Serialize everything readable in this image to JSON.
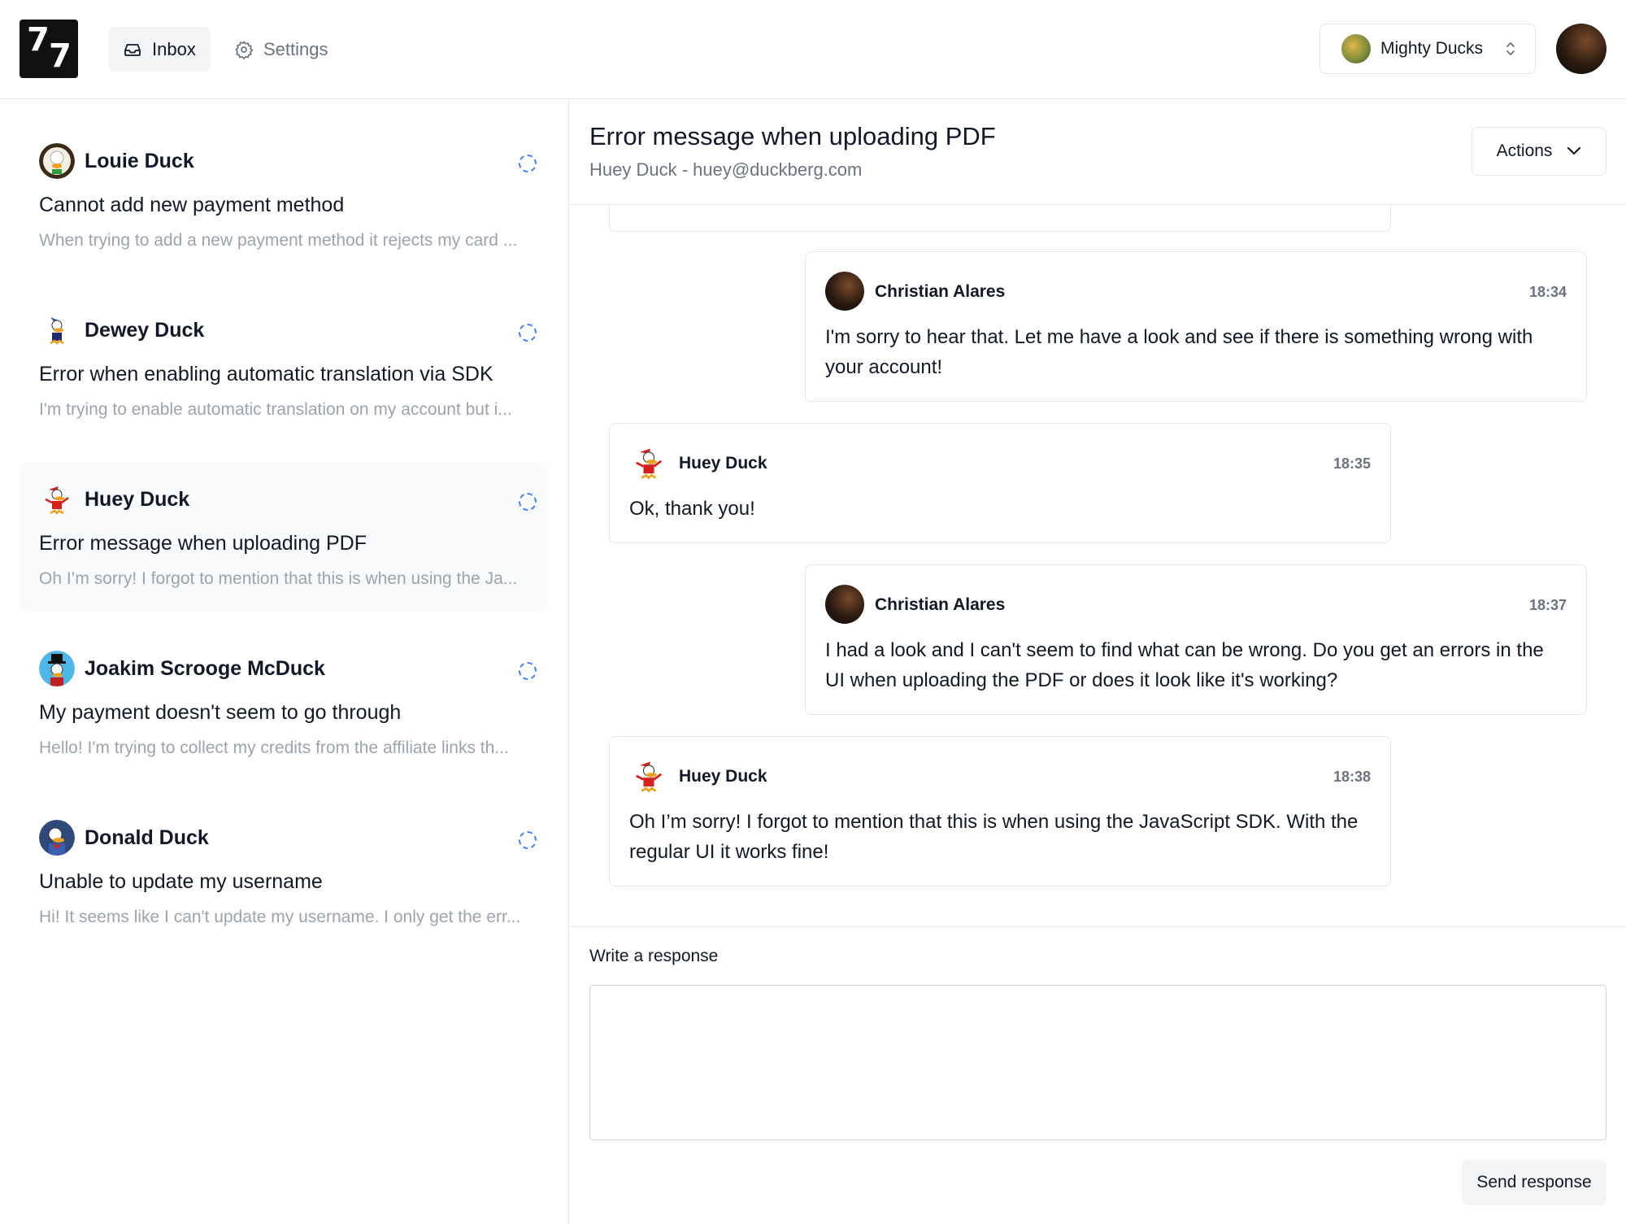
{
  "header": {
    "logo": {
      "d1": "7",
      "d2": "7"
    },
    "nav": {
      "inbox": "Inbox",
      "settings": "Settings"
    },
    "org": {
      "name": "Mighty Ducks"
    }
  },
  "sidebar": {
    "tickets": [
      {
        "name": "Louie Duck",
        "subject": "Cannot add new payment method",
        "preview": "When trying to add a new payment method it rejects my card ...",
        "avatar_color": "#f3efe2"
      },
      {
        "name": "Dewey Duck",
        "subject": "Error when enabling automatic translation via SDK",
        "preview": "I'm trying to enable automatic translation on my account but i...",
        "avatar_color": "#ffffff"
      },
      {
        "name": "Huey Duck",
        "subject": "Error message when uploading PDF",
        "preview": "Oh I’m sorry! I forgot to mention that this is when using the Ja...",
        "avatar_color": "#ffffff"
      },
      {
        "name": "Joakim Scrooge McDuck",
        "subject": "My payment doesn't seem to go through",
        "preview": "Hello! I'm trying to collect my credits from the affiliate links th...",
        "avatar_color": "#4db8e8"
      },
      {
        "name": "Donald Duck",
        "subject": "Unable to update my username",
        "preview": "Hi! It seems like I can't update my username. I only get the err...",
        "avatar_color": "#2f4a7a"
      }
    ]
  },
  "main": {
    "title": "Error message when uploading PDF",
    "subtitle": "Huey Duck - huey@duckberg.com",
    "actions_label": "Actions",
    "messages": [
      {
        "author": "Christian Alares",
        "time": "18:34",
        "text": "I'm sorry to hear that. Let me have a look and see if there is something wrong with your account!"
      },
      {
        "author": "Huey Duck",
        "time": "18:35",
        "text": "Ok, thank you!"
      },
      {
        "author": "Christian Alares",
        "time": "18:37",
        "text": "I had a look and I can't seem to find what can be wrong. Do you get an errors in the UI when uploading the PDF or does it look like it's working?"
      },
      {
        "author": "Huey Duck",
        "time": "18:38",
        "text": "Oh I’m sorry! I forgot to mention that this is when using the JavaScript SDK. With the regular UI it works fine!"
      }
    ],
    "composer": {
      "label": "Write a response",
      "placeholder": "",
      "send_label": "Send response"
    }
  },
  "colors": {
    "accent": "#3b82f6",
    "muted_text": "#9ca3af",
    "border": "#e5e7eb"
  }
}
